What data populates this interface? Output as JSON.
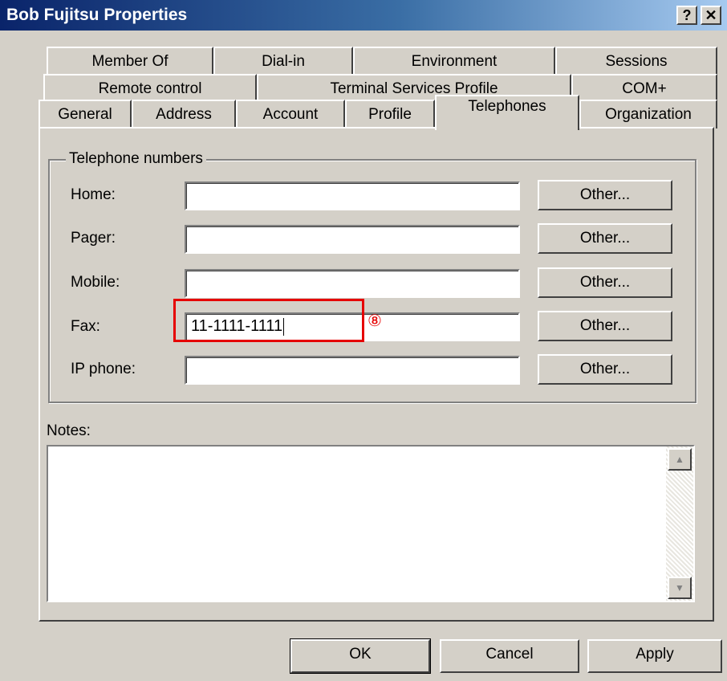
{
  "window": {
    "title": "Bob Fujitsu Properties",
    "help_button": "?",
    "close_button": "✕"
  },
  "tabs": {
    "row1": [
      "Member Of",
      "Dial-in",
      "Environment",
      "Sessions"
    ],
    "row2": [
      "Remote control",
      "Terminal Services Profile",
      "COM+"
    ],
    "row3": [
      "General",
      "Address",
      "Account",
      "Profile",
      "Telephones",
      "Organization"
    ],
    "active": "Telephones"
  },
  "telephone_group": {
    "legend": "Telephone numbers",
    "fields": [
      {
        "label": "Home:",
        "value": "",
        "other_label": "Other..."
      },
      {
        "label": "Pager:",
        "value": "",
        "other_label": "Other..."
      },
      {
        "label": "Mobile:",
        "value": "",
        "other_label": "Other..."
      },
      {
        "label": "Fax:",
        "value": "11-1111-1111",
        "other_label": "Other..."
      },
      {
        "label": "IP phone:",
        "value": "",
        "other_label": "Other..."
      }
    ]
  },
  "notes": {
    "label": "Notes:",
    "value": ""
  },
  "annotation": {
    "step_marker": "⑧",
    "highlight_color": "#e60000"
  },
  "footer": {
    "ok_label": "OK",
    "cancel_label": "Cancel",
    "apply_label": "Apply"
  },
  "colors": {
    "dialog_face": "#d4d0c8",
    "titlebar_start": "#0a246a",
    "titlebar_end": "#a6caf0"
  }
}
